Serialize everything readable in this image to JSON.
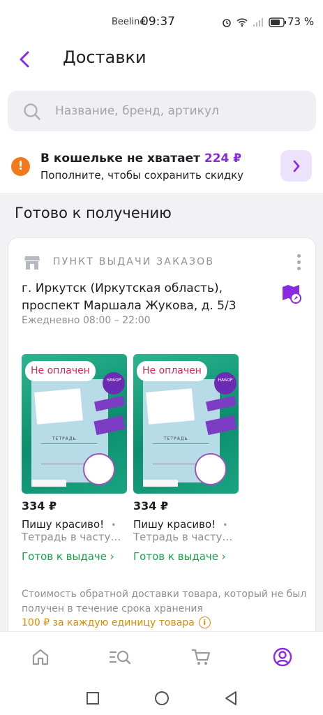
{
  "status_bar": {
    "carrier": "Beeline",
    "time": "09:37",
    "battery": "73 %"
  },
  "header": {
    "title": "Доставки",
    "back_icon": "chevron-left-icon"
  },
  "search": {
    "placeholder": "Название, бренд, артикул",
    "value": ""
  },
  "wallet": {
    "title_prefix": "В кошельке не хватает",
    "amount": "224 ₽",
    "subtitle": "Пополните, чтобы сохранить скидку"
  },
  "section": {
    "title": "Готово к получению"
  },
  "pickup": {
    "label": "ПУНКТ ВЫДАЧИ ЗАКАЗОВ",
    "address_line1": "г. Иркутск (Иркутская область),",
    "address_line2": "проспект Маршала Жукова, д. 5/3",
    "hours": "Ежедневно 08:00 – 22:00"
  },
  "products": [
    {
      "status_pill": "Не оплачен",
      "price": "334 ₽",
      "name": "Пишу красиво!",
      "description": "Тетрадь в частую …",
      "status": "Готов к выдаче ›"
    },
    {
      "status_pill": "Не оплачен",
      "price": "334 ₽",
      "name": "Пишу красиво!",
      "description": "Тетрадь в частую …",
      "status": "Готов к выдаче ›"
    }
  ],
  "return_info": {
    "note": "Стоимость обратной доставки товара, который не был получен в течение срока хранения",
    "price": "100 ₽ за каждую единицу товара"
  },
  "tabbar": {
    "items": [
      "home-icon",
      "catalog-search-icon",
      "cart-icon",
      "profile-icon"
    ],
    "active_color": "#8a2be2"
  },
  "colors": {
    "accent": "#8a2be2",
    "warning": "#f27a1a",
    "success": "#16a34a",
    "unpaid": "#e0245e"
  }
}
